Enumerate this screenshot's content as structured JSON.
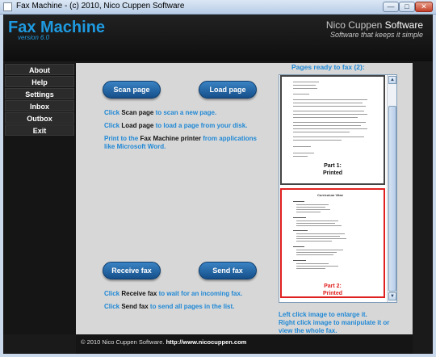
{
  "window": {
    "title": "Fax Machine  -  (c) 2010, Nico Cuppen Software"
  },
  "header": {
    "app_title": "Fax Machine",
    "version": "version 6.0",
    "brand_plain": "Nico Cuppen ",
    "brand_bold": "Software",
    "tagline": "Software that keeps it simple"
  },
  "sidebar": {
    "items": [
      {
        "label": "About"
      },
      {
        "label": "Help"
      },
      {
        "label": "Settings"
      },
      {
        "label": "Inbox"
      },
      {
        "label": "Outbox"
      },
      {
        "label": "Exit"
      }
    ]
  },
  "buttons": {
    "scan": "Scan page",
    "load": "Load page",
    "receive": "Receive fax",
    "send": "Send fax"
  },
  "hints": {
    "scan_pre": "Click ",
    "scan_key": "Scan page",
    "scan_post": " to scan a new page.",
    "load_pre": "Click ",
    "load_key": "Load page",
    "load_post": " to load a page from your disk.",
    "print_pre": "Print to the ",
    "print_key": "Fax Machine printer",
    "print_post": " from applications",
    "print_line2": "like Microsoft Word.",
    "receive_pre": "Click ",
    "receive_key": "Receive fax",
    "receive_post": " to wait for an incoming fax.",
    "send_pre": "Click ",
    "send_key": "Send fax",
    "send_post": " to send all pages in the list."
  },
  "pages": {
    "title": "Pages ready to fax (2):",
    "items": [
      {
        "part": "Part 1:",
        "status": "Printed",
        "selected": false
      },
      {
        "part": "Part 2:",
        "status": "Printed",
        "selected": true
      }
    ],
    "thumb2_heading": "Curriculum Vitae",
    "help1": "Left click image to enlarge it.",
    "help2": "Right click image to manipulate it or",
    "help3": "view the whole fax."
  },
  "footer": {
    "pre": "© 2010 Nico Cuppen Software. ",
    "url": "http://www.nicocuppen.com"
  },
  "colors": {
    "accent": "#1f88d6",
    "button": "#1d5e9e",
    "selected_border": "#e02020"
  }
}
